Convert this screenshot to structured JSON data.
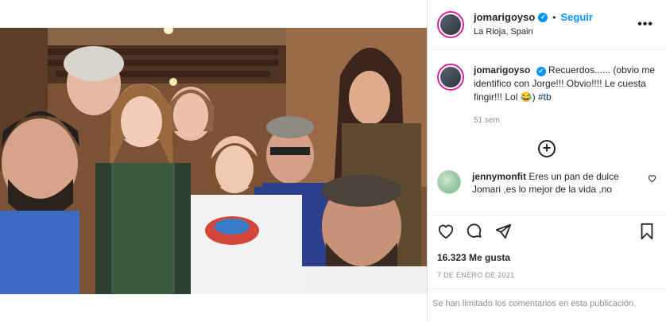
{
  "header": {
    "username": "jomarigoyso",
    "verified_mark": "✓",
    "separator": "•",
    "follow_label": "Seguir",
    "location": "La Rioja, Spain",
    "more_label": "•••"
  },
  "caption": {
    "username": "jomarigoyso",
    "text": "Recuerdos...... (obvio me identifico con Jorge!!! Obvio!!!! Le cuesta fingir!!! Lol 😂)",
    "hashtag": "#tb",
    "time": "51 sem"
  },
  "load_more": {
    "label": "+"
  },
  "comment": {
    "username": "jennymonfit",
    "text": "Eres un pan de dulce Jomari ,es lo mejor de la vida ,no",
    "like_icon": "heart-outline-icon"
  },
  "actions": {
    "icons": [
      "heart-icon",
      "comment-icon",
      "share-icon",
      "bookmark-icon"
    ],
    "likes": "16.323 Me gusta",
    "date": "7 DE ENERO DE 2021"
  },
  "footer": {
    "limited_text": "Se han limitado los comentarios en esta publicación."
  },
  "colors": {
    "accent": "#0095f6",
    "muted": "#8e8e8e",
    "border": "#dbdbdb",
    "ring": "#d6249f"
  }
}
